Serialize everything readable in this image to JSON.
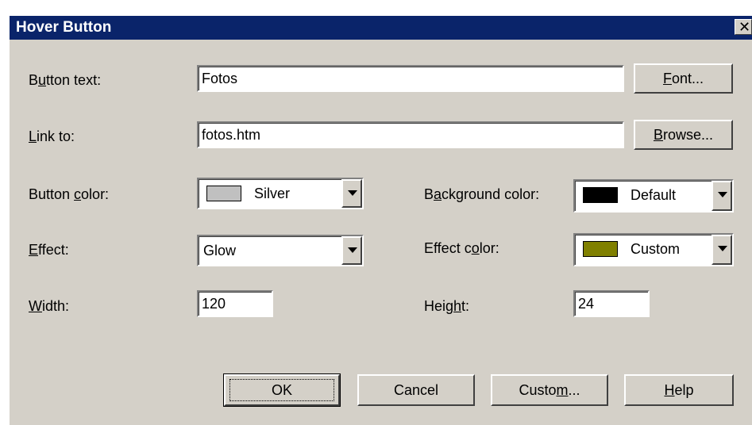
{
  "window": {
    "title": "Hover Button",
    "close_glyph": "✕"
  },
  "fields": {
    "button_text": {
      "pre": "B",
      "ul": "u",
      "post": "tton text:",
      "value": "Fotos"
    },
    "link_to": {
      "pre": "",
      "ul": "L",
      "post": "ink to:",
      "value": "fotos.htm"
    },
    "button_color": {
      "pre": "Button ",
      "ul": "c",
      "post": "olor:",
      "value": "Silver",
      "swatch": "#c0c0c0"
    },
    "effect": {
      "pre": "",
      "ul": "E",
      "post": "ffect:",
      "value": "Glow"
    },
    "width": {
      "pre": "",
      "ul": "W",
      "post": "idth:",
      "value": "120"
    },
    "background_color": {
      "pre": "B",
      "ul": "a",
      "post": "ckground color:",
      "value": "Default",
      "swatch": "#000000"
    },
    "effect_color": {
      "pre": "Effect c",
      "ul": "o",
      "post": "lor:",
      "value": "Custom",
      "swatch": "#808000"
    },
    "height": {
      "pre": "Heig",
      "ul": "h",
      "post": "t:",
      "value": "24"
    }
  },
  "buttons": {
    "font": {
      "pre": "",
      "ul": "F",
      "post": "ont..."
    },
    "browse": {
      "pre": "",
      "ul": "B",
      "post": "rowse..."
    },
    "ok": {
      "label": "OK"
    },
    "cancel": {
      "label": "Cancel"
    },
    "custom": {
      "pre": "Custo",
      "ul": "m",
      "post": "..."
    },
    "help": {
      "pre": "",
      "ul": "H",
      "post": "elp"
    }
  }
}
